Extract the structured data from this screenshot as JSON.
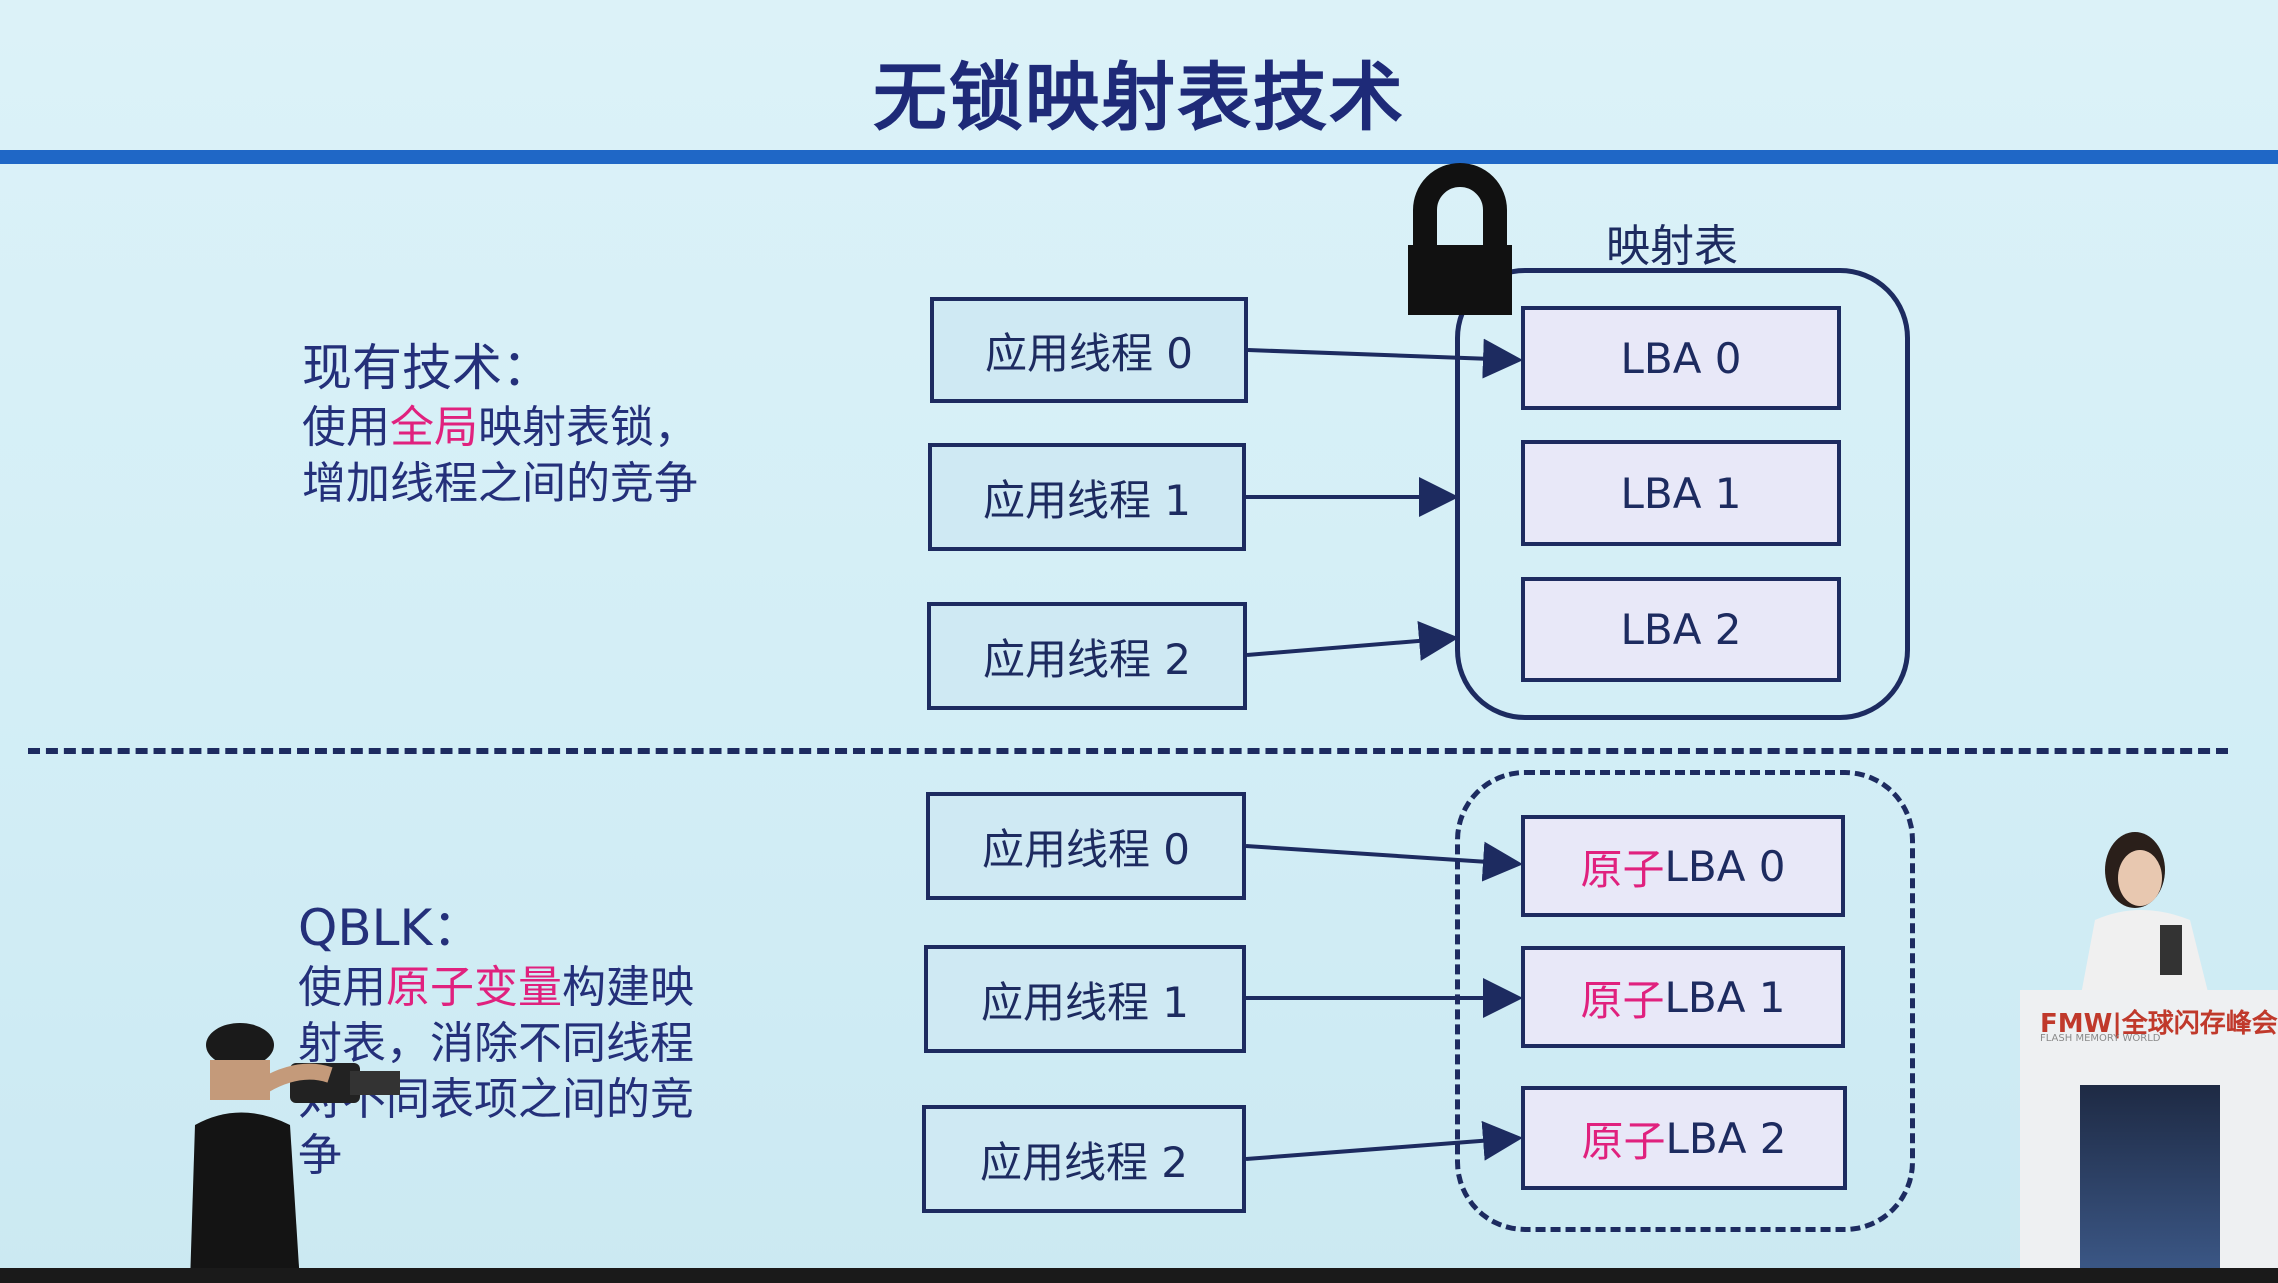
{
  "slide": {
    "title": "无锁映射表技术",
    "existing": {
      "heading": "现有技术：",
      "line1_pre": "使用",
      "line1_hl": "全局",
      "line1_post": "映射表锁，",
      "line2": "增加线程之间的竞争"
    },
    "qblk": {
      "heading": "QBLK：",
      "line1_pre": "使用",
      "line1_hl": "原子变量",
      "line1_post": "构建映",
      "line2": "射表，消除不同线程",
      "line3": "对不同表项之间的竞",
      "line4": "争"
    },
    "top_diagram": {
      "table_label": "映射表",
      "threads": [
        "应用线程 0",
        "应用线程 1",
        "应用线程 2"
      ],
      "entries": [
        "LBA 0",
        "LBA 1",
        "LBA 2"
      ]
    },
    "bottom_diagram": {
      "threads": [
        "应用线程 0",
        "应用线程 1",
        "应用线程 2"
      ],
      "entry_prefix": "原子",
      "entries": [
        "LBA 0",
        "LBA 1",
        "LBA 2"
      ]
    },
    "podium": {
      "logo": "FMW|全球闪存峰会",
      "sub": "FLASH MEMORY WORLD"
    },
    "colors": {
      "accent_rule": "#1f67c6",
      "title": "#1e2a78",
      "highlight": "#e0217e",
      "stroke": "#1d2b60"
    }
  }
}
